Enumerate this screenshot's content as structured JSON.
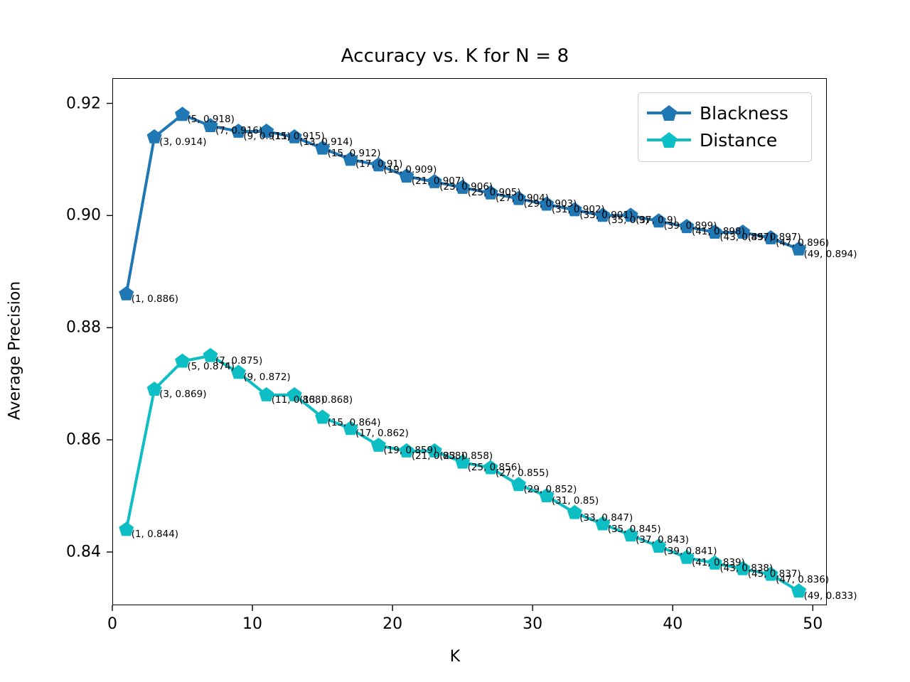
{
  "chart_data": {
    "type": "line",
    "title": "Accuracy vs. K for N = 8",
    "xlabel": "K",
    "ylabel": "Average Precision",
    "xlim": [
      0,
      51
    ],
    "ylim": [
      0.8305,
      0.9245
    ],
    "xticks": [
      "0",
      "10",
      "20",
      "30",
      "40",
      "50"
    ],
    "xtick_values": [
      0,
      10,
      20,
      30,
      40,
      50
    ],
    "yticks": [
      "0.84",
      "0.86",
      "0.88",
      "0.90",
      "0.92"
    ],
    "ytick_values": [
      0.84,
      0.86,
      0.88,
      0.9,
      0.92
    ],
    "grid": false,
    "legend_position": "upper right",
    "marker": "pentagon",
    "x": [
      1,
      3,
      5,
      7,
      9,
      11,
      13,
      15,
      17,
      19,
      21,
      23,
      25,
      27,
      29,
      31,
      33,
      35,
      37,
      39,
      41,
      43,
      45,
      47,
      49
    ],
    "series": [
      {
        "name": "Blackness",
        "color": "#1f77b4",
        "values": [
          0.886,
          0.914,
          0.918,
          0.916,
          0.915,
          0.915,
          0.914,
          0.912,
          0.91,
          0.909,
          0.907,
          0.906,
          0.905,
          0.904,
          0.903,
          0.902,
          0.901,
          0.9,
          0.9,
          0.899,
          0.898,
          0.897,
          0.897,
          0.896,
          0.894
        ],
        "point_labels": [
          "(1, 0.886)",
          "(3, 0.914)",
          "(5, 0.918)",
          "(7, 0.916)",
          "(9, 0.915)",
          "(11, 0.915)",
          "(13, 0.914)",
          "(15, 0.912)",
          "(17, 0.91)",
          "(19, 0.909)",
          "(21, 0.907)",
          "(23, 0.906)",
          "(25, 0.905)",
          "(27, 0.904)",
          "(29, 0.903)",
          "(31, 0.902)",
          "(33, 0.901)",
          "(35, 0.9)",
          "(37, 0.9)",
          "(39, 0.899)",
          "(41, 0.898)",
          "(43, 0.897)",
          "(45, 0.897)",
          "(47, 0.896)",
          "(49, 0.894)"
        ]
      },
      {
        "name": "Distance",
        "color": "#0dbfc4",
        "values": [
          0.844,
          0.869,
          0.874,
          0.875,
          0.872,
          0.868,
          0.868,
          0.864,
          0.862,
          0.859,
          0.858,
          0.858,
          0.856,
          0.855,
          0.852,
          0.85,
          0.847,
          0.845,
          0.843,
          0.841,
          0.839,
          0.838,
          0.837,
          0.836,
          0.833
        ],
        "point_labels": [
          "(1, 0.844)",
          "(3, 0.869)",
          "(5, 0.874)",
          "(7, 0.875)",
          "(9, 0.872)",
          "(11, 0.868)",
          "(13, 0.868)",
          "(15, 0.864)",
          "(17, 0.862)",
          "(19, 0.859)",
          "(21, 0.858)",
          "(23, 0.858)",
          "(25, 0.856)",
          "(27, 0.855)",
          "(29, 0.852)",
          "(31, 0.85)",
          "(33, 0.847)",
          "(35, 0.845)",
          "(37, 0.843)",
          "(39, 0.841)",
          "(41, 0.839)",
          "(43, 0.838)",
          "(45, 0.837)",
          "(47, 0.836)",
          "(49, 0.833)"
        ]
      }
    ]
  },
  "legend": {
    "entries": [
      {
        "label": "Blackness",
        "color": "#1f77b4"
      },
      {
        "label": "Distance",
        "color": "#0dbfc4"
      }
    ]
  }
}
